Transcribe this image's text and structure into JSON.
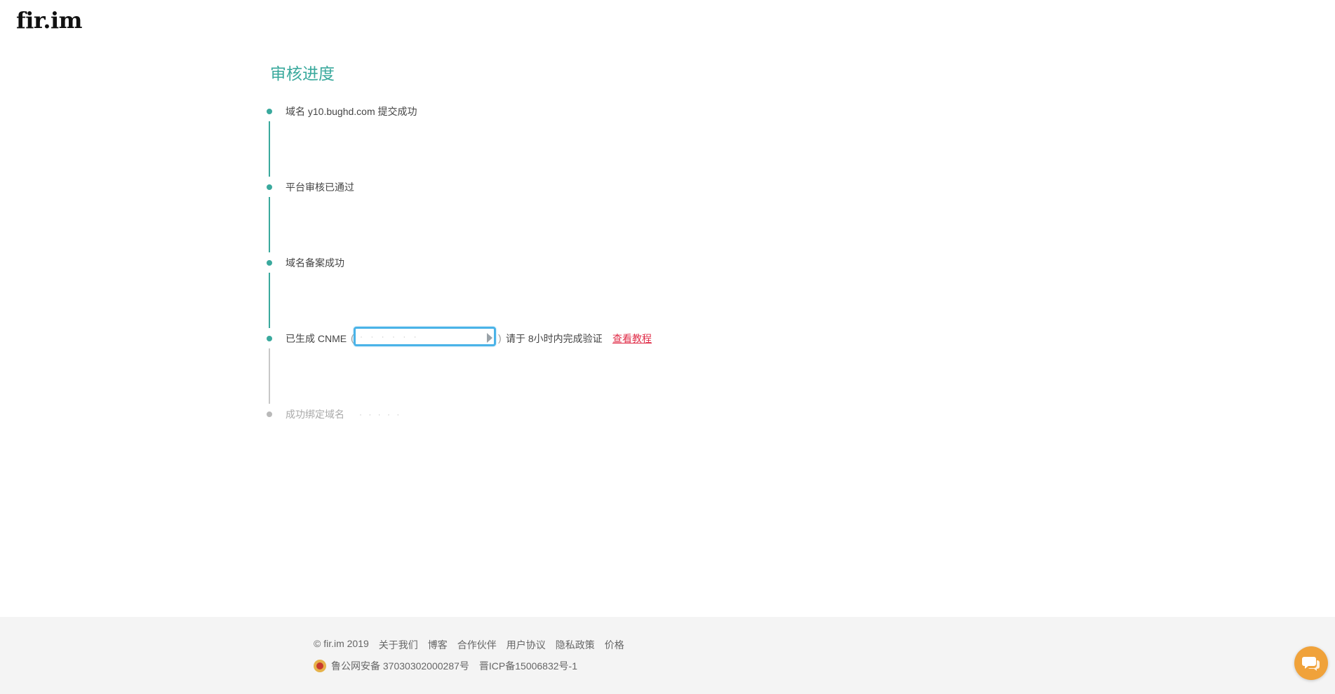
{
  "header": {
    "logo_text": "fir.im"
  },
  "main": {
    "title": "审核进度",
    "steps": [
      {
        "label": "域名 y10.bughd.com 提交成功",
        "status": "done"
      },
      {
        "label": "平台审核已通过",
        "status": "done"
      },
      {
        "label": "域名备案成功",
        "status": "done"
      },
      {
        "label": "已生成 CNME",
        "status": "current"
      },
      {
        "label": "成功绑定域名",
        "status": "pending"
      }
    ],
    "cname_hint": "请于 8小时内完成验证",
    "tutorial_link": "查看教程"
  },
  "footer": {
    "links": [
      "© fir.im 2019",
      "关于我们",
      "博客",
      "合作伙伴",
      "用户协议",
      "隐私政策",
      "价格"
    ],
    "police_record": "鲁公网安备 37030302000287号",
    "icp": "晋ICP备15006832号-1"
  },
  "colors": {
    "accent": "#3aa99d",
    "link_red": "#e02d48",
    "cname_border": "#4ab3e8",
    "chat_button": "#f0a23a",
    "footer_bg": "#f4f4f4"
  },
  "icons": [
    "chat-icon",
    "police-badge-icon"
  ]
}
